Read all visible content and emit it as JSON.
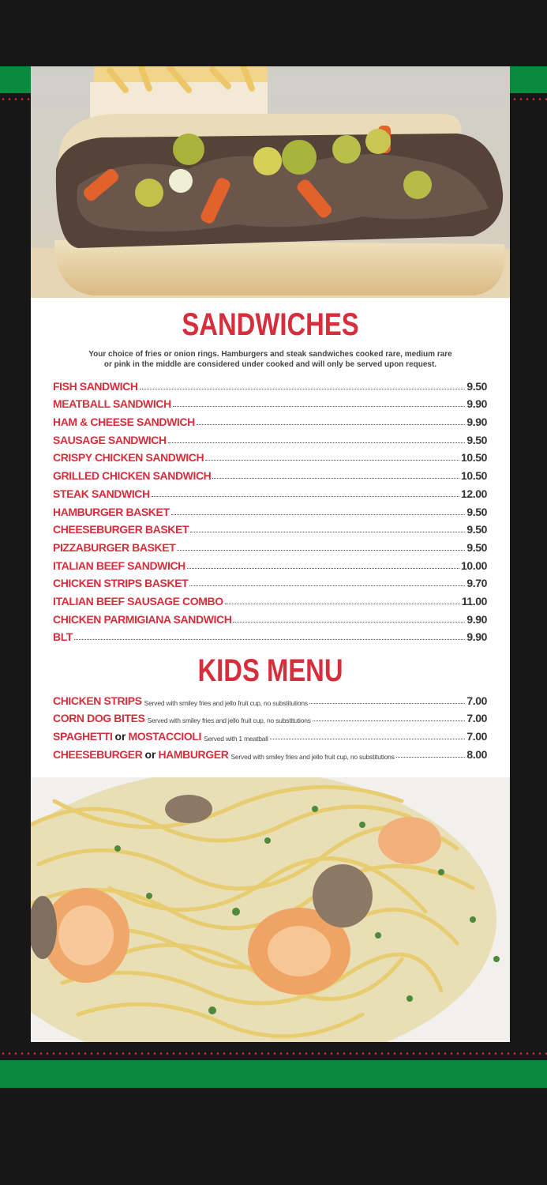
{
  "colors": {
    "accent": "#d42f3c",
    "green": "#0a8a3e",
    "frame": "#171717"
  },
  "images": {
    "top": "italian-beef-sandwich-photo",
    "bottom": "shrimp-pasta-photo"
  },
  "sandwiches": {
    "title": "SANDWICHES",
    "intro_line1": "Your choice of fries or onion rings. Hamburgers and steak sandwiches cooked rare, medium rare",
    "intro_line2": "or pink in the middle are considered under cooked and will only be served upon request.",
    "items": [
      {
        "name": "FISH SANDWICH",
        "price": "9.50"
      },
      {
        "name": "MEATBALL SANDWICH",
        "price": "9.90"
      },
      {
        "name": "HAM & CHEESE SANDWICH",
        "price": "9.90"
      },
      {
        "name": "SAUSAGE SANDWICH",
        "price": "9.50"
      },
      {
        "name": "CRISPY CHICKEN SANDWICH",
        "price": "10.50"
      },
      {
        "name": "GRILLED CHICKEN SANDWICH",
        "price": "10.50"
      },
      {
        "name": "STEAK SANDWICH",
        "price": "12.00"
      },
      {
        "name": "HAMBURGER BASKET",
        "price": "9.50"
      },
      {
        "name": "CHEESEBURGER BASKET",
        "price": "9.50"
      },
      {
        "name": "PIZZABURGER BASKET",
        "price": "9.50"
      },
      {
        "name": "ITALIAN BEEF SANDWICH",
        "price": "10.00"
      },
      {
        "name": "CHICKEN STRIPS BASKET",
        "price": "9.70"
      },
      {
        "name": "ITALIAN BEEF SAUSAGE COMBO",
        "price": "11.00"
      },
      {
        "name": "CHICKEN PARMIGIANA SANDWICH",
        "price": "9.90"
      },
      {
        "name": "BLT",
        "price": "9.90"
      }
    ]
  },
  "kids": {
    "title": "KIDS MENU",
    "items": [
      {
        "name": "CHICKEN STRIPS",
        "note": "Served with smiley fries and jello fruit cup, no substitutions",
        "price": "7.00"
      },
      {
        "name": "CORN DOG BITES",
        "note": "Served with smiley fries and jello fruit cup, no substitutions",
        "price": "7.00"
      },
      {
        "name": "SPAGHETTI",
        "or": "or",
        "name2": "MOSTACCIOLI",
        "note": "Served with 1 meatball",
        "price": "7.00"
      },
      {
        "name": "CHEESEBURGER",
        "or": "or",
        "name2": "HAMBURGER",
        "note": "Served with smiley fries and jello fruit cup, no substitutions",
        "price": "8.00"
      }
    ]
  }
}
